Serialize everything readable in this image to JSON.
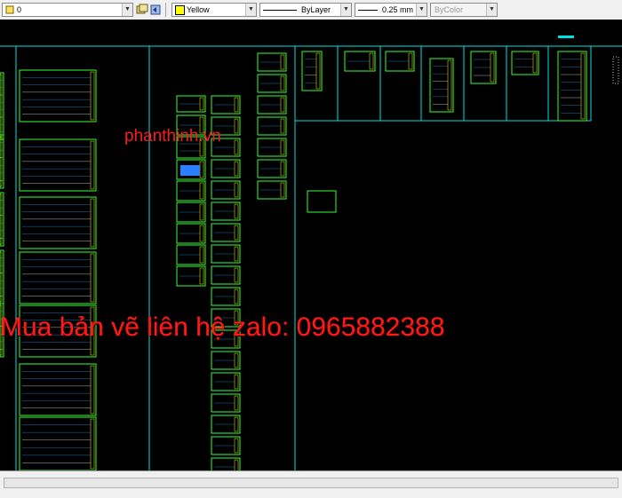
{
  "toolbar": {
    "layer": {
      "value": "0",
      "icon": "layer-state-icon"
    },
    "color": {
      "value": "Yellow",
      "swatch": "#ffff00"
    },
    "linetype": {
      "value": "ByLayer"
    },
    "lineweight": {
      "value": "0.25 mm"
    },
    "plotstyle": {
      "value": "ByColor"
    }
  },
  "canvas": {
    "background": "#000000",
    "frame_color": "#00e0e0",
    "sheet_color": "#33ff33"
  },
  "watermarks": {
    "site": "phanthinh.vn",
    "contact": "Mua bản vẽ liên hệ zalo: 0965882388",
    "color": "#ff1a1a"
  }
}
